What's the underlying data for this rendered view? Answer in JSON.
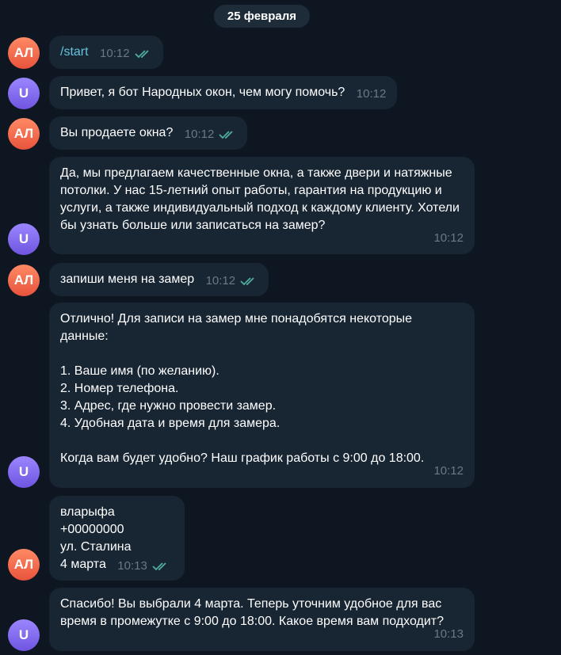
{
  "chat": {
    "date_label": "25 февраля",
    "messages": [
      {
        "sender": "user",
        "avatar": "АЛ",
        "text": "/start",
        "time": "10:12",
        "read": true
      },
      {
        "sender": "bot",
        "avatar": "U",
        "text": "Привет, я бот Народных окон, чем могу помочь?",
        "time": "10:12"
      },
      {
        "sender": "user",
        "avatar": "АЛ",
        "text": "Вы продаете окна?",
        "time": "10:12",
        "read": true
      },
      {
        "sender": "bot",
        "avatar": "U",
        "text": "Да, мы предлагаем качественные окна, а также двери и натяжные потолки. У нас 15-летний опыт работы, гарантия на продукцию и услуги, а также индивидуальный подход к каждому клиенту. Хотели бы узнать больше или записаться на замер?",
        "time": "10:12"
      },
      {
        "sender": "user",
        "avatar": "АЛ",
        "text": "запиши меня на замер",
        "time": "10:12",
        "read": true
      },
      {
        "sender": "bot",
        "avatar": "U",
        "text": "Отлично! Для записи на замер мне понадобятся некоторые данные:\n\n1. Ваше имя (по желанию).\n2. Номер телефона.\n3. Адрес, где нужно провести замер.\n4. Удобная дата и время для замера.\n\nКогда вам будет удобно? Наш график работы с 9:00 до 18:00.",
        "time": "10:12"
      },
      {
        "sender": "user",
        "avatar": "АЛ",
        "text_lines": [
          "вларыфа",
          "+00000000",
          "ул. Сталина",
          "4 марта"
        ],
        "time": "10:13",
        "read": true
      },
      {
        "sender": "bot",
        "avatar": "U",
        "text": "Спасибо! Вы выбрали 4 марта. Теперь уточним удобное для вас время в промежутке с 9:00 до 18:00. Какое время вам подходит?",
        "time": "10:13"
      }
    ]
  },
  "colors": {
    "background": "#0e1621",
    "bubble": "#182533",
    "time": "#6c7883",
    "check": "#4fae9f",
    "command_link": "#65c3dd"
  },
  "icons": {
    "read_receipt": "double-check-icon"
  }
}
